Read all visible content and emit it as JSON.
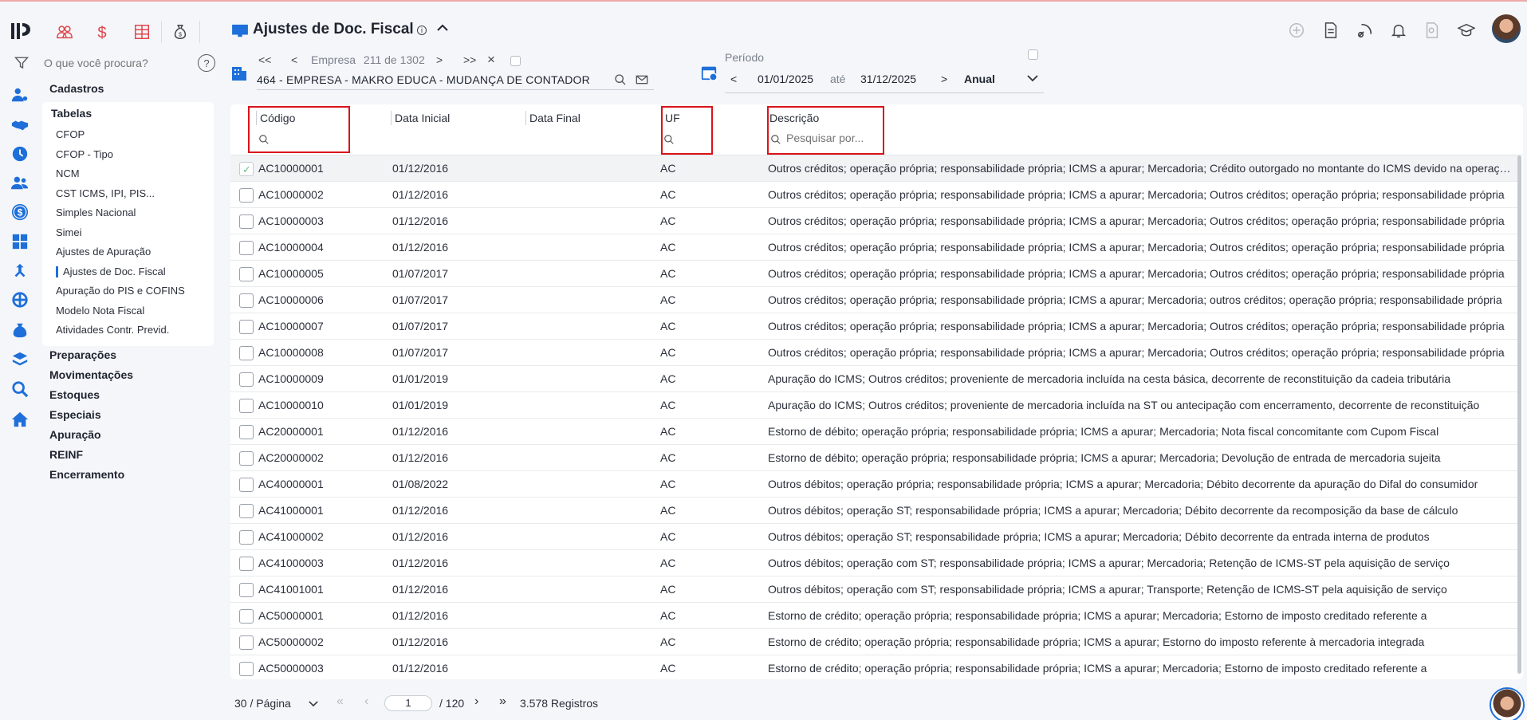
{
  "search": {
    "placeholder": "O que você procura?",
    "help": "?"
  },
  "menu": {
    "cadastros": "Cadastros",
    "tabelas": "Tabelas",
    "items": [
      "CFOP",
      "CFOP - Tipo",
      "NCM",
      "CST ICMS, IPI, PIS...",
      "Simples Nacional",
      "Simei",
      "Ajustes de Apuração",
      "Ajustes de Doc. Fiscal",
      "Apuração do PIS e COFINS",
      "Modelo Nota Fiscal",
      "Atividades Contr. Previd."
    ],
    "sections": [
      "Preparações",
      "Movimentações",
      "Estoques",
      "Especiais",
      "Apuração",
      "REINF",
      "Encerramento"
    ]
  },
  "header": {
    "title": "Ajustes de Doc. Fiscal",
    "info": "i",
    "collapse": "⌃"
  },
  "company": {
    "first": "<<",
    "prev": "<",
    "label": "Empresa",
    "index": "211",
    "of": "de",
    "total": "1302",
    "next": ">",
    "last": ">>",
    "clear": "×",
    "name": "464 - EMPRESA - MAKRO EDUCA - MUDANÇA DE CONTADOR"
  },
  "period": {
    "label": "Período",
    "prev": "<",
    "start": "01/01/2025",
    "until": "até",
    "end": "31/12/2025",
    "next": ">",
    "mode": "Anual"
  },
  "table": {
    "columns": {
      "codigo": "Código",
      "data_inicial": "Data Inicial",
      "data_final": "Data Final",
      "uf": "UF",
      "descricao": "Descrição"
    },
    "desc_search_placeholder": "Pesquisar por...",
    "rows": [
      {
        "codigo": "AC10000001",
        "data_inicial": "01/12/2016",
        "uf": "AC",
        "descricao": "Outros créditos; operação própria; responsabilidade própria; ICMS a apurar; Mercadoria; Crédito outorgado no montante do ICMS devido na operação subsequente",
        "selected": true
      },
      {
        "codigo": "AC10000002",
        "data_inicial": "01/12/2016",
        "uf": "AC",
        "descricao": "Outros créditos; operação própria; responsabilidade própria; ICMS a apurar; Mercadoria; Outros créditos; operação própria; responsabilidade própria"
      },
      {
        "codigo": "AC10000003",
        "data_inicial": "01/12/2016",
        "uf": "AC",
        "descricao": "Outros créditos; operação própria; responsabilidade própria; ICMS a apurar; Mercadoria; Outros créditos; operação própria; responsabilidade própria"
      },
      {
        "codigo": "AC10000004",
        "data_inicial": "01/12/2016",
        "uf": "AC",
        "descricao": "Outros créditos; operação própria; responsabilidade própria; ICMS a apurar; Mercadoria; Outros créditos; operação própria; responsabilidade própria"
      },
      {
        "codigo": "AC10000005",
        "data_inicial": "01/07/2017",
        "uf": "AC",
        "descricao": "Outros créditos; operação própria; responsabilidade própria; ICMS a apurar; Mercadoria; Outros créditos; operação própria; responsabilidade própria"
      },
      {
        "codigo": "AC10000006",
        "data_inicial": "01/07/2017",
        "uf": "AC",
        "descricao": "Outros créditos; operação própria; responsabilidade própria; ICMS a apurar; Mercadoria; outros créditos; operação própria; responsabilidade própria"
      },
      {
        "codigo": "AC10000007",
        "data_inicial": "01/07/2017",
        "uf": "AC",
        "descricao": "Outros créditos; operação própria; responsabilidade própria; ICMS a apurar; Mercadoria; Outros créditos; operação própria; responsabilidade própria"
      },
      {
        "codigo": "AC10000008",
        "data_inicial": "01/07/2017",
        "uf": "AC",
        "descricao": "Outros créditos; operação própria; responsabilidade própria; ICMS a apurar; Mercadoria; Outros créditos; operação própria; responsabilidade própria"
      },
      {
        "codigo": "AC10000009",
        "data_inicial": "01/01/2019",
        "uf": "AC",
        "descricao": "Apuração do ICMS; Outros créditos; proveniente de mercadoria incluída na cesta básica, decorrente de reconstituição da cadeia tributária"
      },
      {
        "codigo": "AC10000010",
        "data_inicial": "01/01/2019",
        "uf": "AC",
        "descricao": "Apuração do ICMS; Outros créditos; proveniente de mercadoria incluída na ST ou antecipação com encerramento, decorrente de reconstituição"
      },
      {
        "codigo": "AC20000001",
        "data_inicial": "01/12/2016",
        "uf": "AC",
        "descricao": "Estorno de débito; operação própria; responsabilidade própria; ICMS a apurar; Mercadoria; Nota fiscal concomitante com Cupom Fiscal"
      },
      {
        "codigo": "AC20000002",
        "data_inicial": "01/12/2016",
        "uf": "AC",
        "descricao": "Estorno de débito; operação própria; responsabilidade própria; ICMS a apurar; Mercadoria; Devolução de entrada de mercadoria sujeita"
      },
      {
        "codigo": "AC40000001",
        "data_inicial": "01/08/2022",
        "uf": "AC",
        "descricao": "Outros débitos; operação própria; responsabilidade própria; ICMS a apurar; Mercadoria; Débito decorrente da apuração do Difal do consumidor"
      },
      {
        "codigo": "AC41000001",
        "data_inicial": "01/12/2016",
        "uf": "AC",
        "descricao": "Outros débitos; operação ST; responsabilidade própria; ICMS a apurar; Mercadoria; Débito decorrente da recomposição da base de cálculo"
      },
      {
        "codigo": "AC41000002",
        "data_inicial": "01/12/2016",
        "uf": "AC",
        "descricao": "Outros débitos; operação ST; responsabilidade própria; ICMS a apurar; Mercadoria; Débito decorrente da entrada interna de produtos"
      },
      {
        "codigo": "AC41000003",
        "data_inicial": "01/12/2016",
        "uf": "AC",
        "descricao": "Outros débitos; operação com ST; responsabilidade própria; ICMS a apurar; Mercadoria; Retenção de ICMS-ST pela aquisição de serviço"
      },
      {
        "codigo": "AC41001001",
        "data_inicial": "01/12/2016",
        "uf": "AC",
        "descricao": "Outros débitos; operação com ST; responsabilidade própria; ICMS a apurar; Transporte; Retenção de ICMS-ST pela aquisição de serviço"
      },
      {
        "codigo": "AC50000001",
        "data_inicial": "01/12/2016",
        "uf": "AC",
        "descricao": "Estorno de crédito; operação própria; responsabilidade própria; ICMS a apurar; Mercadoria; Estorno de imposto creditado referente a"
      },
      {
        "codigo": "AC50000002",
        "data_inicial": "01/12/2016",
        "uf": "AC",
        "descricao": "Estorno de crédito; operação própria; responsabilidade própria; ICMS a apurar; Estorno do imposto referente à mercadoria integrada"
      },
      {
        "codigo": "AC50000003",
        "data_inicial": "01/12/2016",
        "uf": "AC",
        "descricao": "Estorno de crédito; operação própria; responsabilidade própria; ICMS a apurar; Mercadoria; Estorno de imposto creditado referente a"
      }
    ]
  },
  "pagination": {
    "per_page": "30 / Página",
    "first": "«",
    "prev": "‹",
    "page": "1",
    "of_total": "/ 120",
    "next": "›",
    "last": "»",
    "records": "3.578 Registros"
  },
  "colors": {
    "accent": "#1e6fd9",
    "highlight": "#d9141b",
    "quick_icons": "#e0454b"
  }
}
